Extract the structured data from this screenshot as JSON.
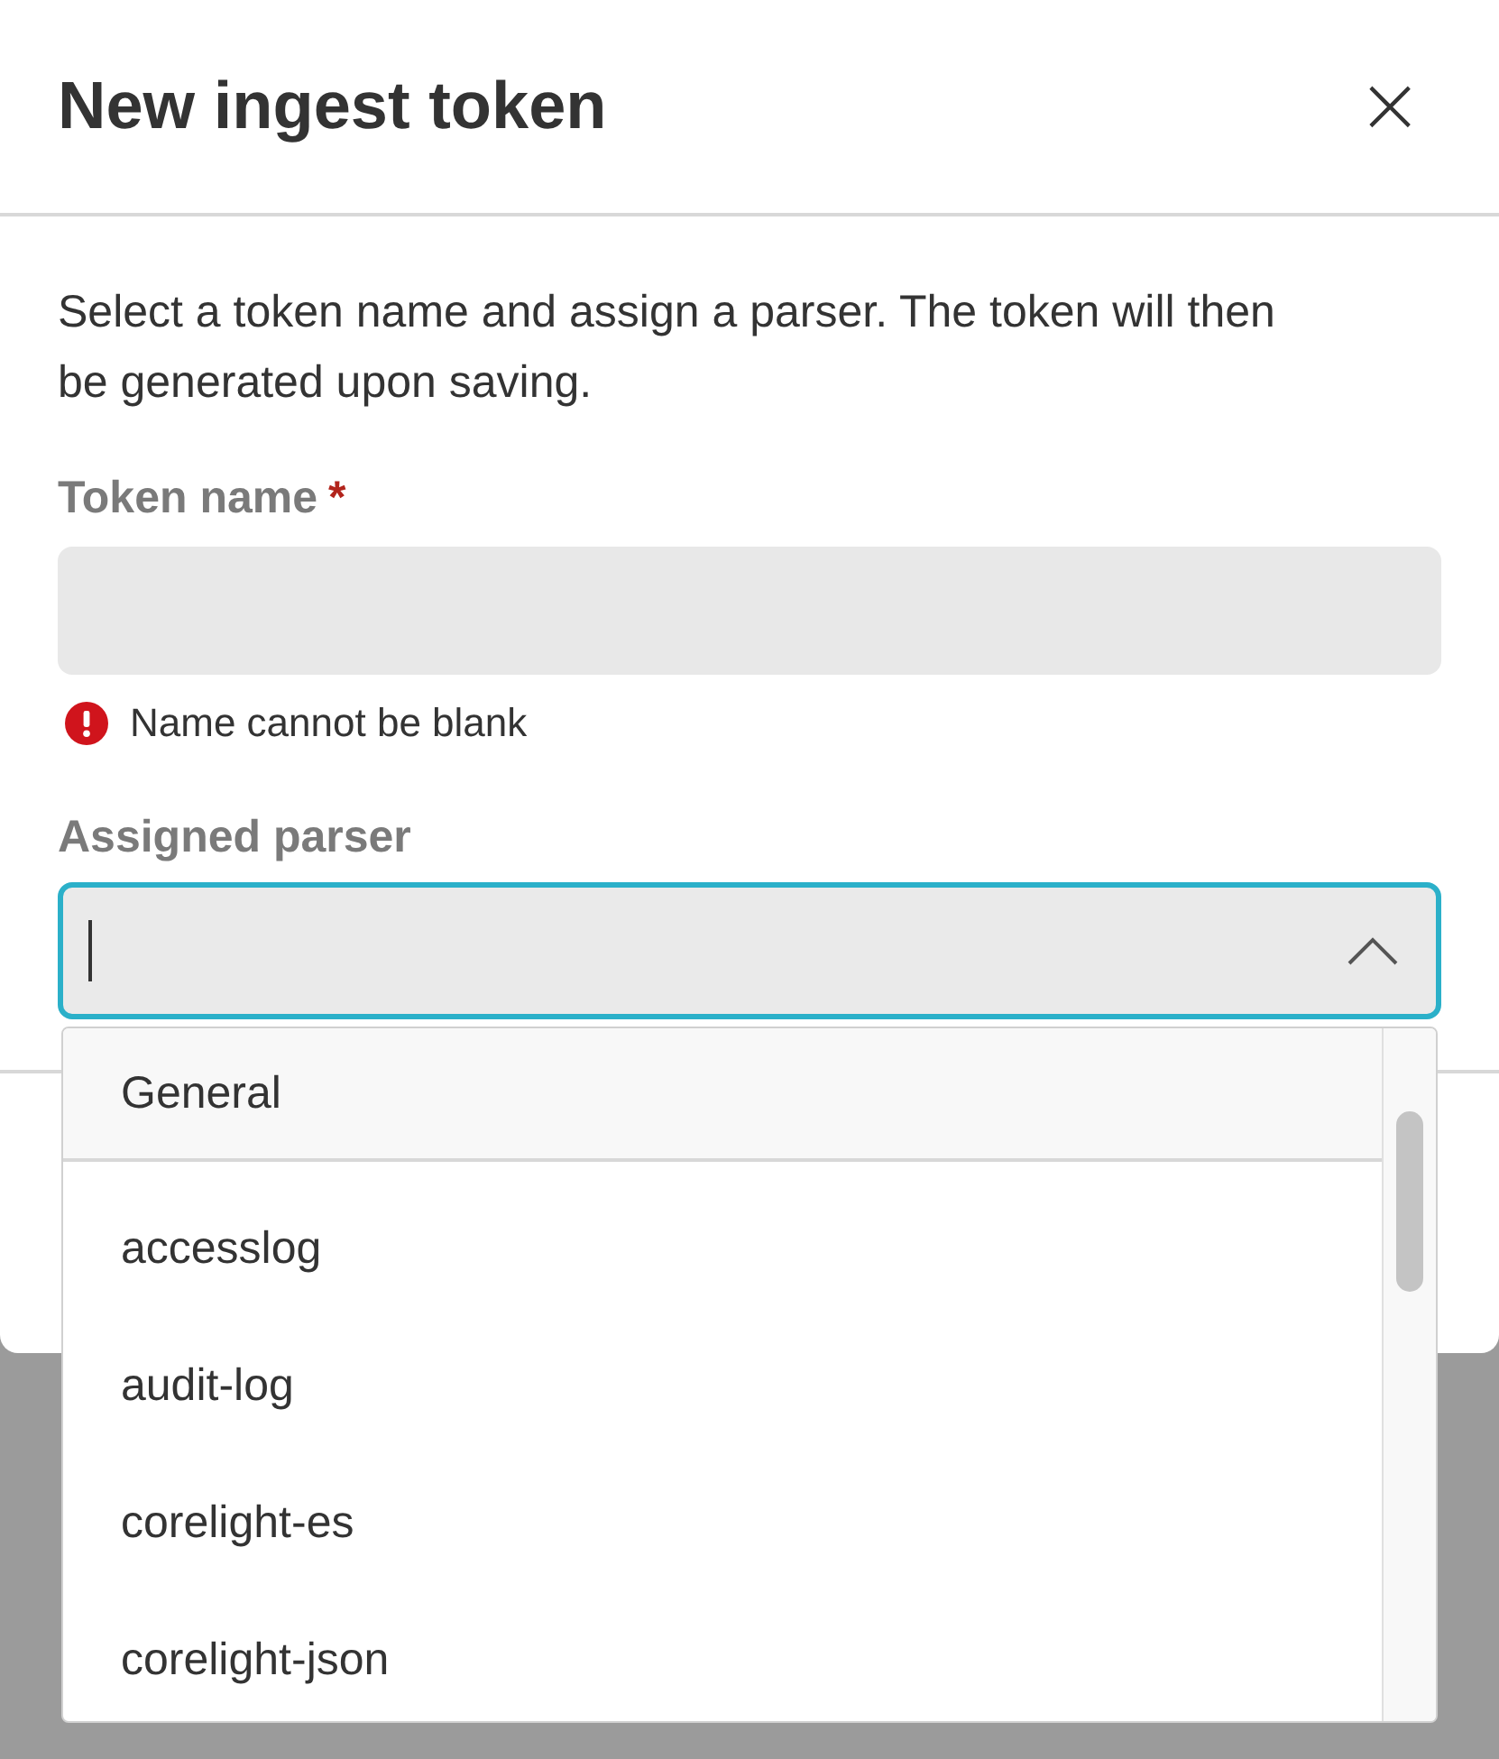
{
  "dialog": {
    "title": "New ingest token",
    "close": "×",
    "description": "Select a token name and assign a parser. The token will then be generated upon saving."
  },
  "token_name": {
    "label": "Token name",
    "required": true,
    "required_mark": "*",
    "error": "Name cannot be blank"
  },
  "parser": {
    "label": "Assigned parser",
    "expanded": true,
    "focused": true,
    "options": [
      {
        "label": "General",
        "selected": true
      },
      {
        "label": "accesslog",
        "selected": false
      },
      {
        "label": "audit-log",
        "selected": false
      },
      {
        "label": "corelight-es",
        "selected": false
      },
      {
        "label": "corelight-json",
        "selected": false
      }
    ]
  }
}
